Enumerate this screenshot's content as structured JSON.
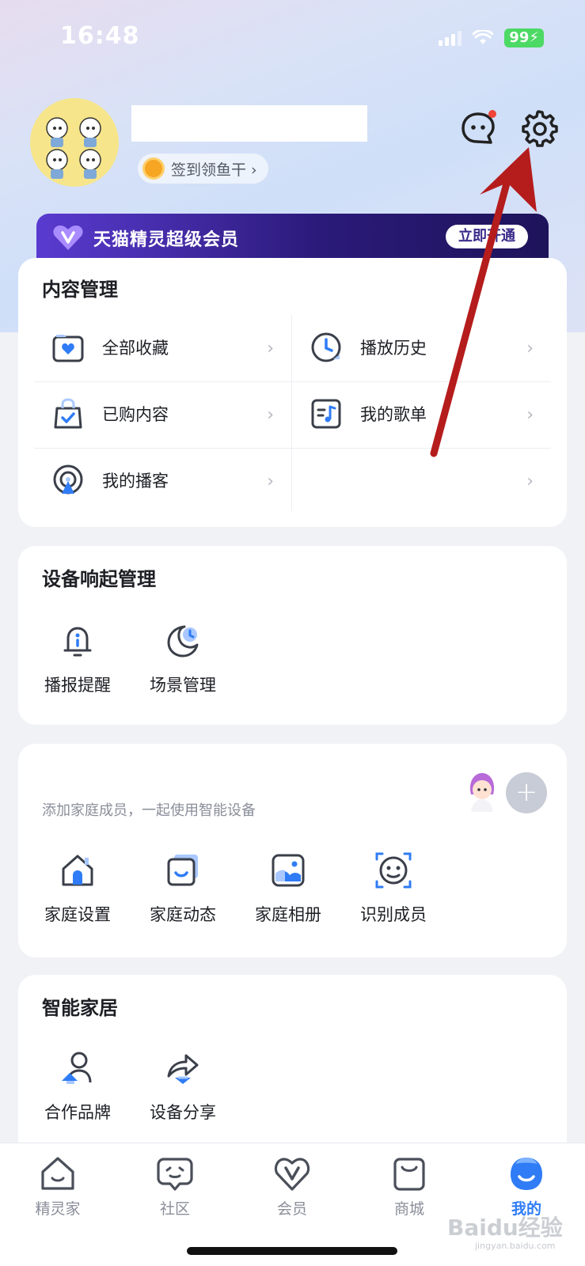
{
  "status_bar": {
    "time": "16:48",
    "battery": "99"
  },
  "profile": {
    "checkin_label": "签到领鱼干 ›"
  },
  "vip": {
    "title": "天猫精灵超级会员",
    "cta": "立即开通"
  },
  "content_management": {
    "title": "内容管理",
    "items": [
      {
        "label": "全部收藏",
        "icon": "favorite-folder-icon"
      },
      {
        "label": "播放历史",
        "icon": "history-clock-icon"
      },
      {
        "label": "已购内容",
        "icon": "shopping-bag-icon"
      },
      {
        "label": "我的歌单",
        "icon": "playlist-icon"
      },
      {
        "label": "我的播客",
        "icon": "podcast-icon"
      },
      {
        "label": "",
        "icon": ""
      }
    ]
  },
  "device_trigger": {
    "title": "设备响起管理",
    "items": [
      {
        "label": "播报提醒",
        "icon": "bell-icon"
      },
      {
        "label": "场景管理",
        "icon": "scene-moon-icon"
      }
    ]
  },
  "family": {
    "hint": "添加家庭成员，一起使用智能设备",
    "add_symbol": "+",
    "items": [
      {
        "label": "家庭设置",
        "icon": "house-icon"
      },
      {
        "label": "家庭动态",
        "icon": "family-feed-icon"
      },
      {
        "label": "家庭相册",
        "icon": "photo-album-icon"
      },
      {
        "label": "识别成员",
        "icon": "face-scan-icon"
      }
    ]
  },
  "smart_home": {
    "title": "智能家居",
    "items": [
      {
        "label": "合作品牌",
        "icon": "partner-brand-icon"
      },
      {
        "label": "设备分享",
        "icon": "share-arrow-icon"
      }
    ]
  },
  "tabbar": {
    "items": [
      {
        "label": "精灵家",
        "icon": "home-tab-icon"
      },
      {
        "label": "社区",
        "icon": "community-tab-icon"
      },
      {
        "label": "会员",
        "icon": "vip-tab-icon"
      },
      {
        "label": "商城",
        "icon": "mall-tab-icon"
      },
      {
        "label": "我的",
        "icon": "me-tab-icon",
        "active": true
      }
    ]
  },
  "watermark": {
    "brand": "Baidu经验",
    "url": "jingyan.baidu.com"
  },
  "colors": {
    "accent": "#2f7cf6",
    "vip_start": "#5a3bd0",
    "vip_end": "#1e145a",
    "annotation_arrow": "#b51c1c"
  }
}
